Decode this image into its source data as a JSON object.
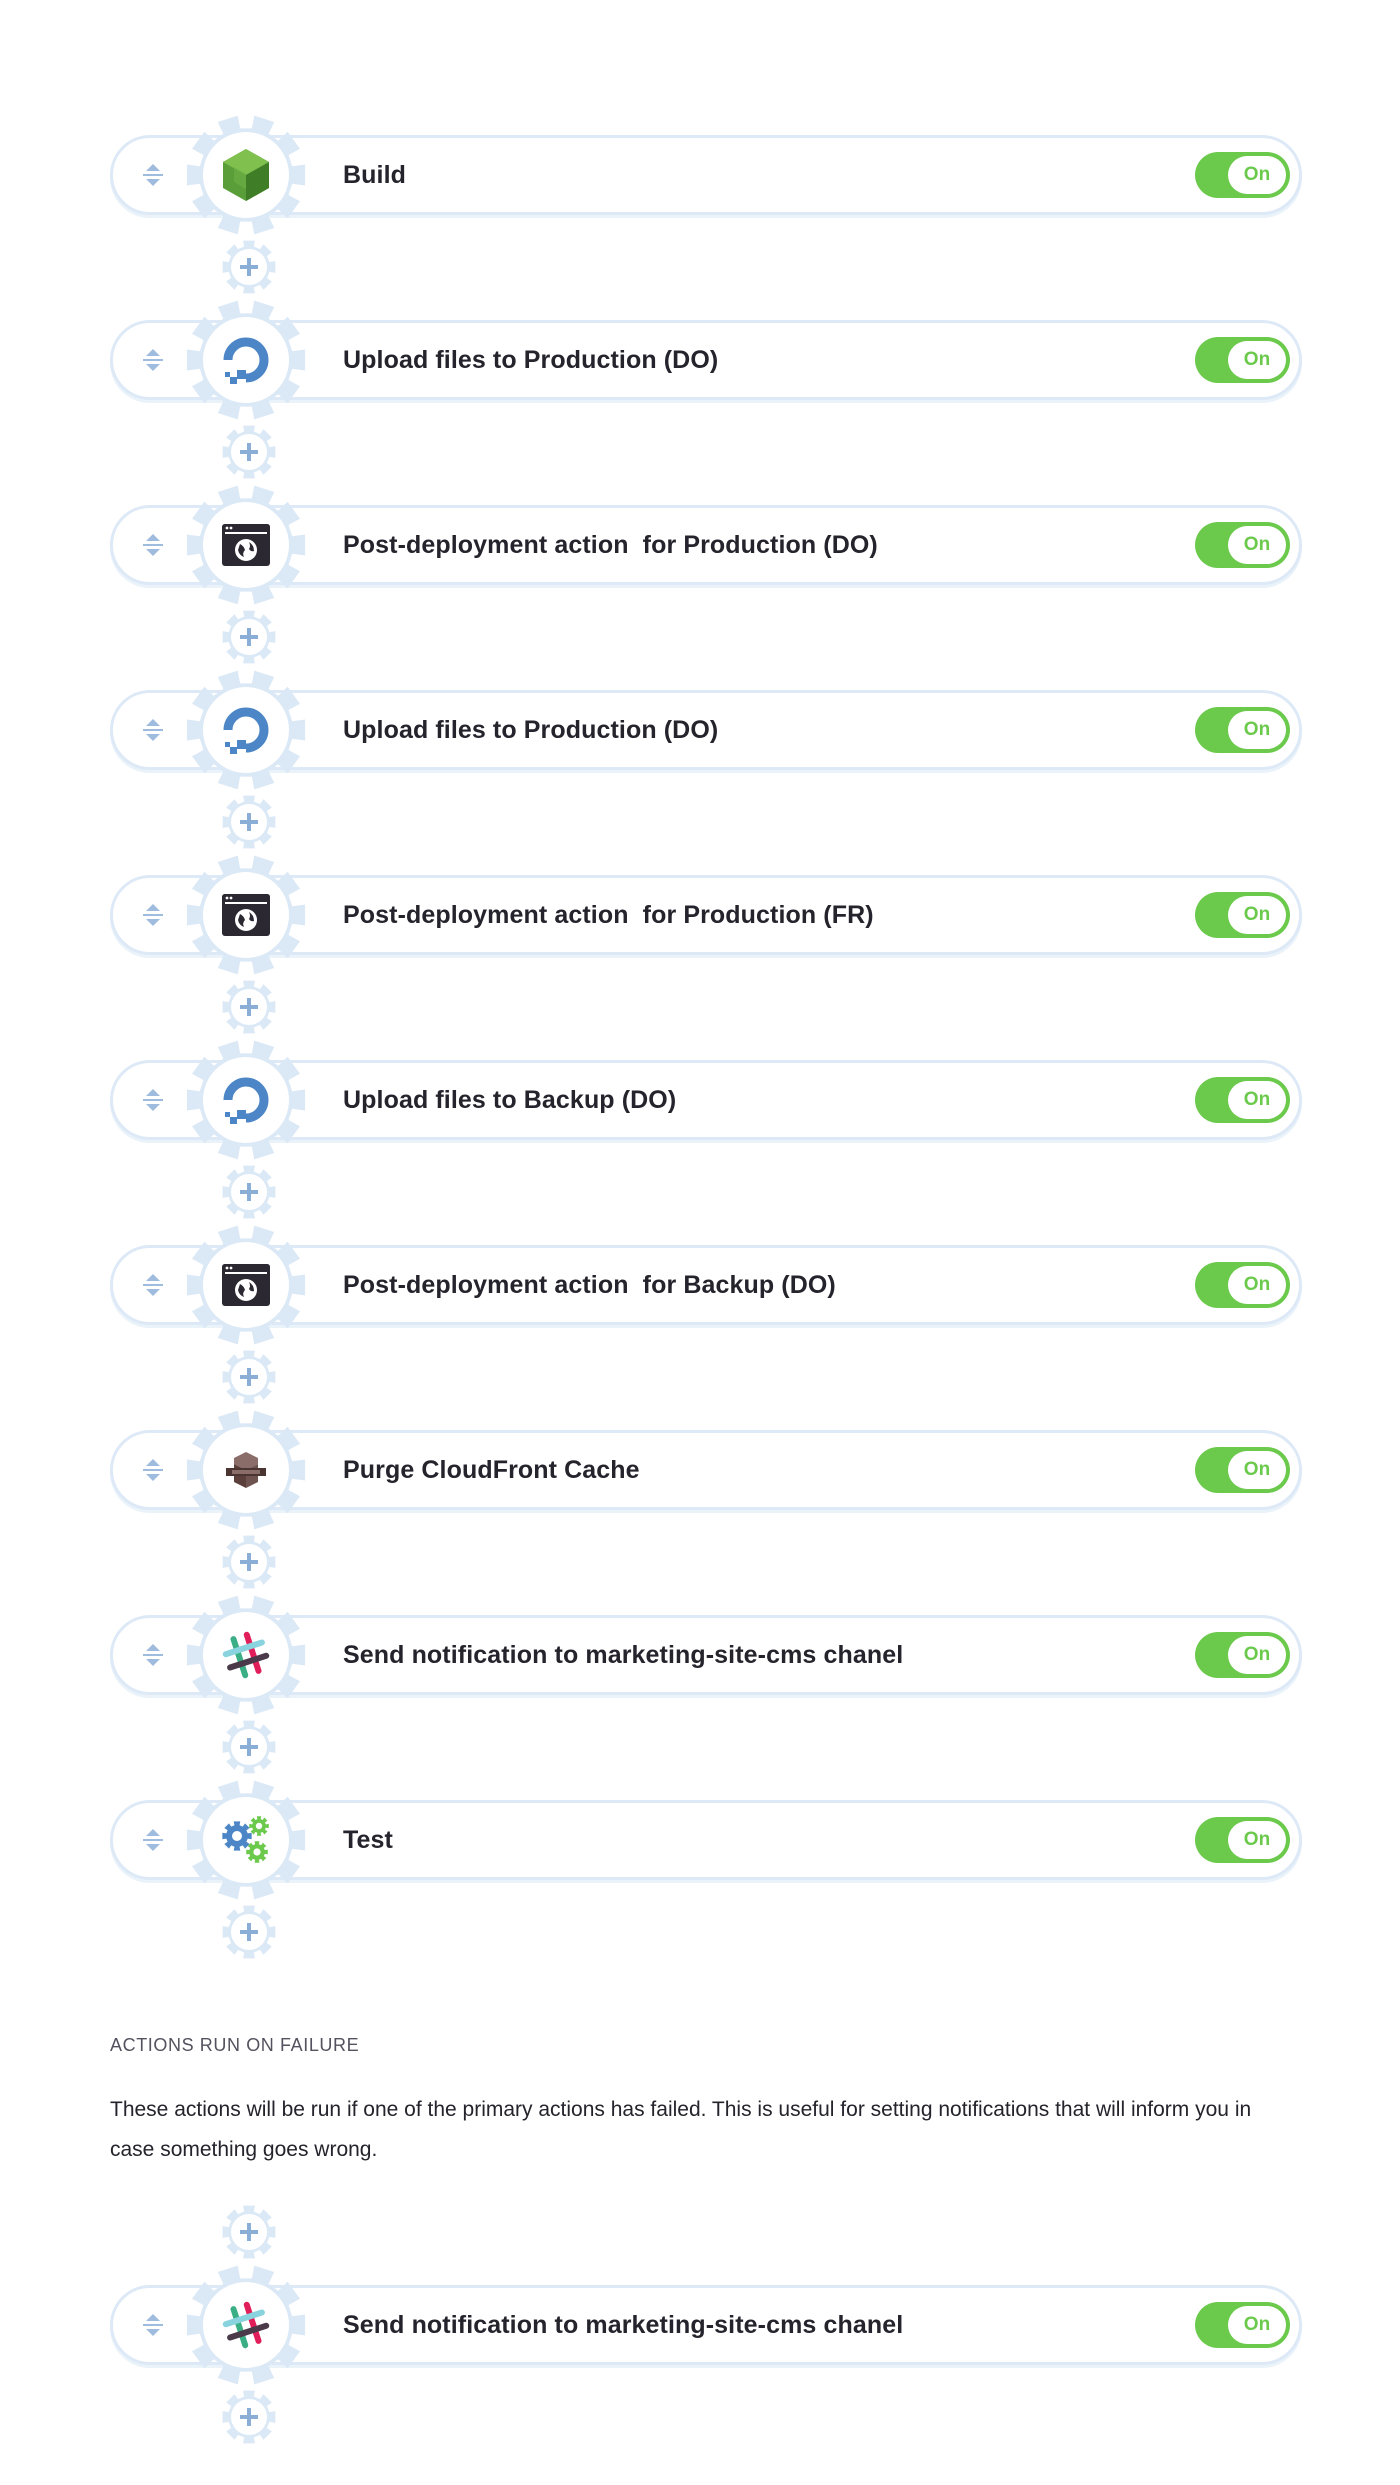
{
  "toggle_text": "On",
  "primary_actions": [
    {
      "label": "Build",
      "icon": "nodejs-icon",
      "state": "On"
    },
    {
      "label": "Upload files to Production (DO)",
      "icon": "digitalocean-icon",
      "state": "On"
    },
    {
      "label": "Post-deployment action  for Production (DO)",
      "icon": "browser-globe-icon",
      "state": "On"
    },
    {
      "label": "Upload files to Production (DO)",
      "icon": "digitalocean-icon",
      "state": "On"
    },
    {
      "label": "Post-deployment action  for Production (FR)",
      "icon": "browser-globe-icon",
      "state": "On"
    },
    {
      "label": "Upload files to Backup (DO)",
      "icon": "digitalocean-icon",
      "state": "On"
    },
    {
      "label": "Post-deployment action  for Backup (DO)",
      "icon": "browser-globe-icon",
      "state": "On"
    },
    {
      "label": "Purge CloudFront Cache",
      "icon": "cloudfront-icon",
      "state": "On"
    },
    {
      "label": "Send notification to marketing-site-cms chanel",
      "icon": "slack-icon",
      "state": "On"
    },
    {
      "label": "Test",
      "icon": "gears-icon",
      "state": "On"
    }
  ],
  "failure_section": {
    "title": "ACTIONS RUN ON FAILURE",
    "description": "These actions will be run if one of the primary actions has failed. This is useful for setting notifications that will inform you in case something goes wrong."
  },
  "failure_actions": [
    {
      "label": "Send notification to marketing-site-cms chanel",
      "icon": "slack-icon",
      "state": "On"
    }
  ],
  "colors": {
    "toggle_on": "#6bc94c",
    "gear": "#dbe8f6",
    "pill_border": "#dde9f6",
    "plus": "#8aaed6",
    "text": "#25232c"
  }
}
